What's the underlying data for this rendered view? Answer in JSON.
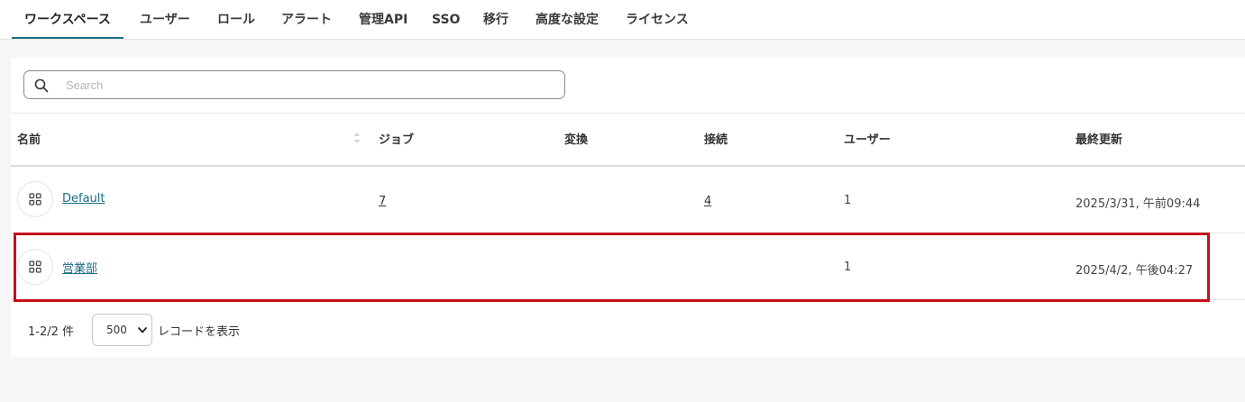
{
  "tabs": [
    {
      "label": "ワークスペース",
      "active": true
    },
    {
      "label": "ユーザー"
    },
    {
      "label": "ロール"
    },
    {
      "label": "アラート"
    },
    {
      "label": "管理API"
    },
    {
      "label": "SSO"
    },
    {
      "label": "移行"
    },
    {
      "label": "高度な設定"
    },
    {
      "label": "ライセンス"
    }
  ],
  "search": {
    "placeholder": "Search",
    "value": "",
    "icon": "search-icon"
  },
  "table": {
    "columns": [
      "名前",
      "ジョブ",
      "変換",
      "接続",
      "ユーザー",
      "最終更新"
    ],
    "rows": [
      {
        "name": "Default",
        "jobs": "7",
        "transforms": "",
        "connections": "4",
        "users": "1",
        "updated": "2025/3/31, 午前09:44",
        "icon": "workspace-grid-icon"
      },
      {
        "name": "営業部",
        "jobs": "",
        "transforms": "",
        "connections": "",
        "users": "1",
        "updated": "2025/4/2, 午後04:27",
        "icon": "workspace-grid-icon",
        "highlighted": true
      }
    ]
  },
  "pager": {
    "range": "1-2/2 件",
    "page_size": "500",
    "suffix": "レコードを表示"
  },
  "colors": {
    "accent": "#1b6e86",
    "highlight": "#c4121a"
  }
}
